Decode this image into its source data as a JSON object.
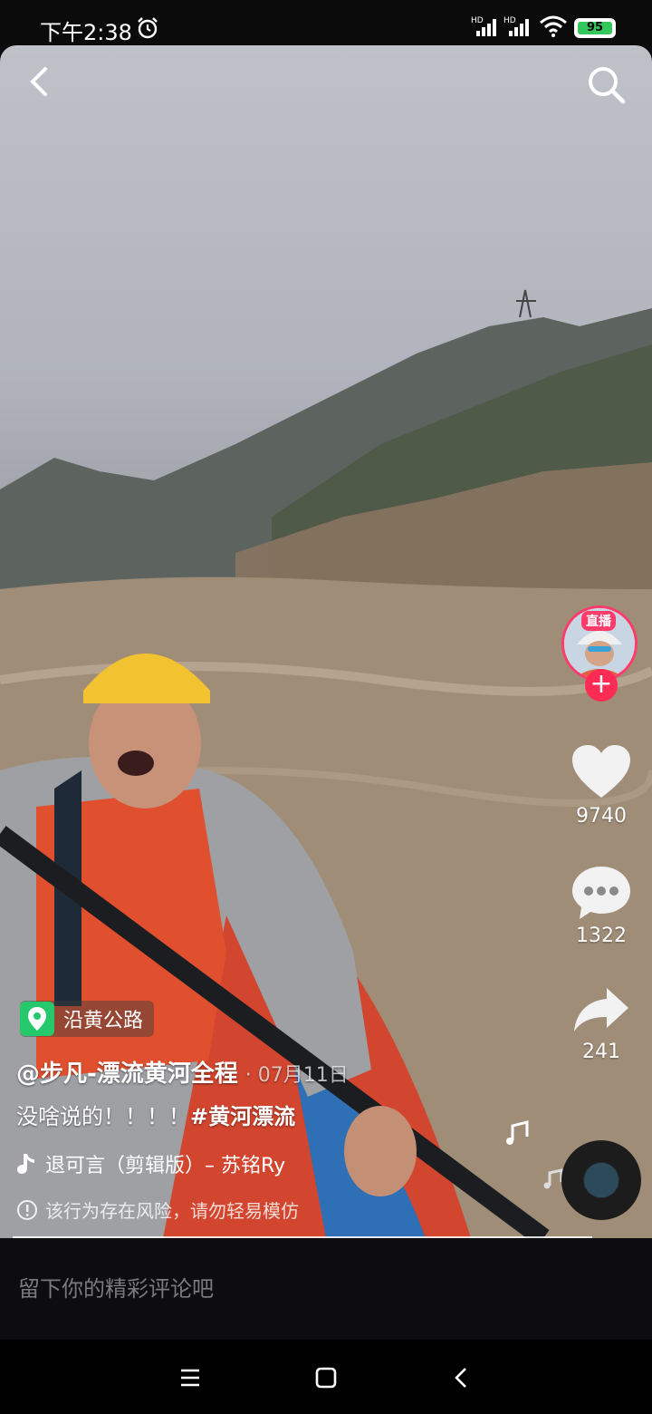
{
  "status_bar": {
    "time": "下午2:38",
    "signal1_label": "HD",
    "signal2_label": "HD",
    "battery": "95"
  },
  "video": {
    "location": "沿黄公路",
    "author": "@步凡-漂流黄河全程",
    "date": "· 07月11日",
    "caption_text": "没啥说的！！！！",
    "caption_hashtag": "#黄河漂流",
    "music": "退可言（剪辑版）– 苏铭Ry",
    "risk_warning": "该行为存在风险，请勿轻易模仿"
  },
  "side_actions": {
    "live_label": "直播",
    "like_count": "9740",
    "comment_count": "1322",
    "share_count": "241"
  },
  "comment_bar": {
    "placeholder": "留下你的精彩评论吧"
  },
  "colors": {
    "accent": "#fe2c55",
    "location_green": "#25c86a",
    "battery_green": "#34c759"
  }
}
